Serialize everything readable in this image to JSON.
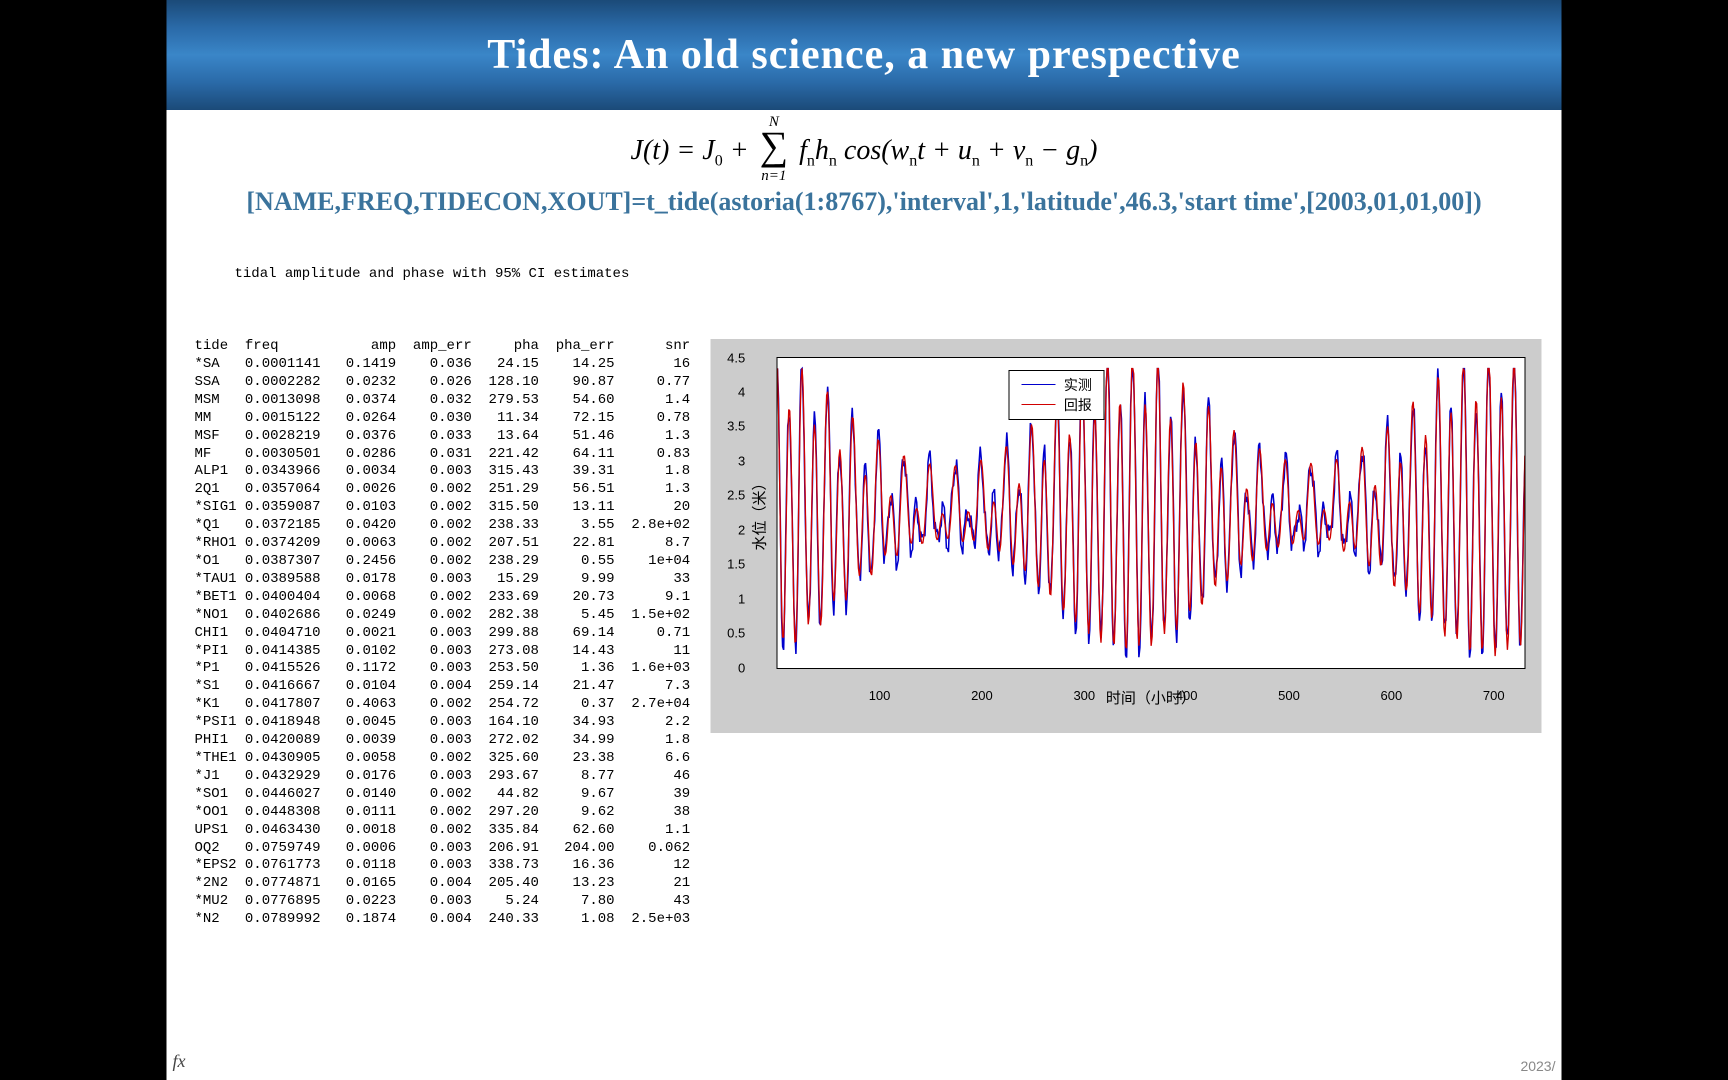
{
  "title": "Tides: An old science, a new prespective",
  "equation": {
    "lhs": "J(t) = J",
    "J0_sub": "0",
    "plus": " + ",
    "sum_top": "N",
    "sum_bot": "n=1",
    "term": " f",
    "n": "n",
    "h": "h",
    "cos": " cos(w",
    "t_part": "t + u",
    "v_part": " + v",
    "g_part": " − g",
    "close": ")"
  },
  "code_line": "[NAME,FREQ,TIDECON,XOUT]=t_tide(astoria(1:8767),'interval',1,'latitude',46.3,'start time',[2003,01,01,00])",
  "table": {
    "caption": "tidal amplitude and phase with 95% CI estimates",
    "headers": [
      "tide",
      "freq",
      "amp",
      "amp_err",
      "pha",
      "pha_err",
      "snr"
    ],
    "rows": [
      [
        "*SA",
        "0.0001141",
        "0.1419",
        "0.036",
        "24.15",
        "14.25",
        "16"
      ],
      [
        "SSA",
        "0.0002282",
        "0.0232",
        "0.026",
        "128.10",
        "90.87",
        "0.77"
      ],
      [
        "MSM",
        "0.0013098",
        "0.0374",
        "0.032",
        "279.53",
        "54.60",
        "1.4"
      ],
      [
        "MM",
        "0.0015122",
        "0.0264",
        "0.030",
        "11.34",
        "72.15",
        "0.78"
      ],
      [
        "MSF",
        "0.0028219",
        "0.0376",
        "0.033",
        "13.64",
        "51.46",
        "1.3"
      ],
      [
        "MF",
        "0.0030501",
        "0.0286",
        "0.031",
        "221.42",
        "64.11",
        "0.83"
      ],
      [
        "ALP1",
        "0.0343966",
        "0.0034",
        "0.003",
        "315.43",
        "39.31",
        "1.8"
      ],
      [
        "2Q1",
        "0.0357064",
        "0.0026",
        "0.002",
        "251.29",
        "56.51",
        "1.3"
      ],
      [
        "*SIG1",
        "0.0359087",
        "0.0103",
        "0.002",
        "315.50",
        "13.11",
        "20"
      ],
      [
        "*Q1",
        "0.0372185",
        "0.0420",
        "0.002",
        "238.33",
        "3.55",
        "2.8e+02"
      ],
      [
        "*RHO1",
        "0.0374209",
        "0.0063",
        "0.002",
        "207.51",
        "22.81",
        "8.7"
      ],
      [
        "*O1",
        "0.0387307",
        "0.2456",
        "0.002",
        "238.29",
        "0.55",
        "1e+04"
      ],
      [
        "*TAU1",
        "0.0389588",
        "0.0178",
        "0.003",
        "15.29",
        "9.99",
        "33"
      ],
      [
        "*BET1",
        "0.0400404",
        "0.0068",
        "0.002",
        "233.69",
        "20.73",
        "9.1"
      ],
      [
        "*NO1",
        "0.0402686",
        "0.0249",
        "0.002",
        "282.38",
        "5.45",
        "1.5e+02"
      ],
      [
        "CHI1",
        "0.0404710",
        "0.0021",
        "0.003",
        "299.88",
        "69.14",
        "0.71"
      ],
      [
        "*PI1",
        "0.0414385",
        "0.0102",
        "0.003",
        "273.08",
        "14.43",
        "11"
      ],
      [
        "*P1",
        "0.0415526",
        "0.1172",
        "0.003",
        "253.50",
        "1.36",
        "1.6e+03"
      ],
      [
        "*S1",
        "0.0416667",
        "0.0104",
        "0.004",
        "259.14",
        "21.47",
        "7.3"
      ],
      [
        "*K1",
        "0.0417807",
        "0.4063",
        "0.002",
        "254.72",
        "0.37",
        "2.7e+04"
      ],
      [
        "*PSI1",
        "0.0418948",
        "0.0045",
        "0.003",
        "164.10",
        "34.93",
        "2.2"
      ],
      [
        "PHI1",
        "0.0420089",
        "0.0039",
        "0.003",
        "272.02",
        "34.99",
        "1.8"
      ],
      [
        "*THE1",
        "0.0430905",
        "0.0058",
        "0.002",
        "325.60",
        "23.38",
        "6.6"
      ],
      [
        "*J1",
        "0.0432929",
        "0.0176",
        "0.003",
        "293.67",
        "8.77",
        "46"
      ],
      [
        "*SO1",
        "0.0446027",
        "0.0140",
        "0.002",
        "44.82",
        "9.67",
        "39"
      ],
      [
        "*OO1",
        "0.0448308",
        "0.0111",
        "0.002",
        "297.20",
        "9.62",
        "38"
      ],
      [
        "UPS1",
        "0.0463430",
        "0.0018",
        "0.002",
        "335.84",
        "62.60",
        "1.1"
      ],
      [
        "OQ2",
        "0.0759749",
        "0.0006",
        "0.003",
        "206.91",
        "204.00",
        "0.062"
      ],
      [
        "*EPS2",
        "0.0761773",
        "0.0118",
        "0.003",
        "338.73",
        "16.36",
        "12"
      ],
      [
        "*2N2",
        "0.0774871",
        "0.0165",
        "0.004",
        "205.40",
        "13.23",
        "21"
      ],
      [
        "*MU2",
        "0.0776895",
        "0.0223",
        "0.003",
        "5.24",
        "7.80",
        "43"
      ],
      [
        "*N2",
        "0.0789992",
        "0.1874",
        "0.004",
        "240.33",
        "1.08",
        "2.5e+03"
      ]
    ]
  },
  "chart_data": {
    "type": "line",
    "title": "",
    "xlabel": "时间（小时）",
    "ylabel": "水位（米）",
    "xlim": [
      0,
      730
    ],
    "ylim": [
      0,
      4.5
    ],
    "x_ticks": [
      100,
      200,
      300,
      400,
      500,
      600,
      700
    ],
    "y_ticks": [
      0,
      0.5,
      1,
      1.5,
      2,
      2.5,
      3,
      3.5,
      4,
      4.5
    ],
    "legend": [
      "实测",
      "回报"
    ],
    "series": [
      {
        "name": "实测",
        "color": "#0000cd",
        "note": "hourly observed water level, amplitude approx 0.5–4.2 m, semidiurnal cycle with spring-neap envelope; min near t≈380 (~0.7m), max near t≈40 (~4.2m)"
      },
      {
        "name": "回报",
        "color": "#d00000",
        "note": "t_tide hindcast reconstruction closely overlapping observed series"
      }
    ]
  },
  "footer": {
    "fx": "fx",
    "date": "2023/"
  }
}
